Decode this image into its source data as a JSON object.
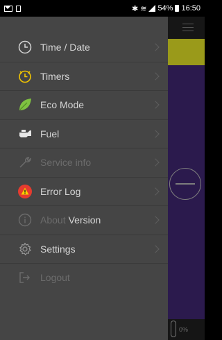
{
  "status_bar": {
    "battery_pct": "54%",
    "time": "16:50"
  },
  "drawer": {
    "items": [
      {
        "label": "Time / Date",
        "icon": "clock-icon",
        "enabled": true,
        "has_chevron": true
      },
      {
        "label": "Timers",
        "icon": "timer-icon",
        "enabled": true,
        "has_chevron": true
      },
      {
        "label": "Eco Mode",
        "icon": "leaf-icon",
        "enabled": true,
        "has_chevron": true
      },
      {
        "label": "Fuel",
        "icon": "fuel-icon",
        "enabled": true,
        "has_chevron": true
      },
      {
        "label": "Service info",
        "icon": "wrench-icon",
        "enabled": false,
        "has_chevron": true
      },
      {
        "label": "Error Log",
        "icon": "warning-icon",
        "enabled": true,
        "has_chevron": true
      },
      {
        "label": "About",
        "suffix": "Version",
        "icon": "info-icon",
        "enabled": false,
        "has_chevron": true
      },
      {
        "label": "Settings",
        "icon": "gear-icon",
        "enabled": true,
        "has_chevron": true
      },
      {
        "label": "Logout",
        "icon": "logout-icon",
        "enabled": false,
        "has_chevron": false
      }
    ]
  },
  "background_app": {
    "gauge_pct": "0%"
  },
  "colors": {
    "drawer_bg": "#454545",
    "accent_yellow": "#f2c500",
    "eco_green": "#7fc241",
    "error_red": "#e53b2f",
    "app_bg": "#2b1a4d"
  }
}
